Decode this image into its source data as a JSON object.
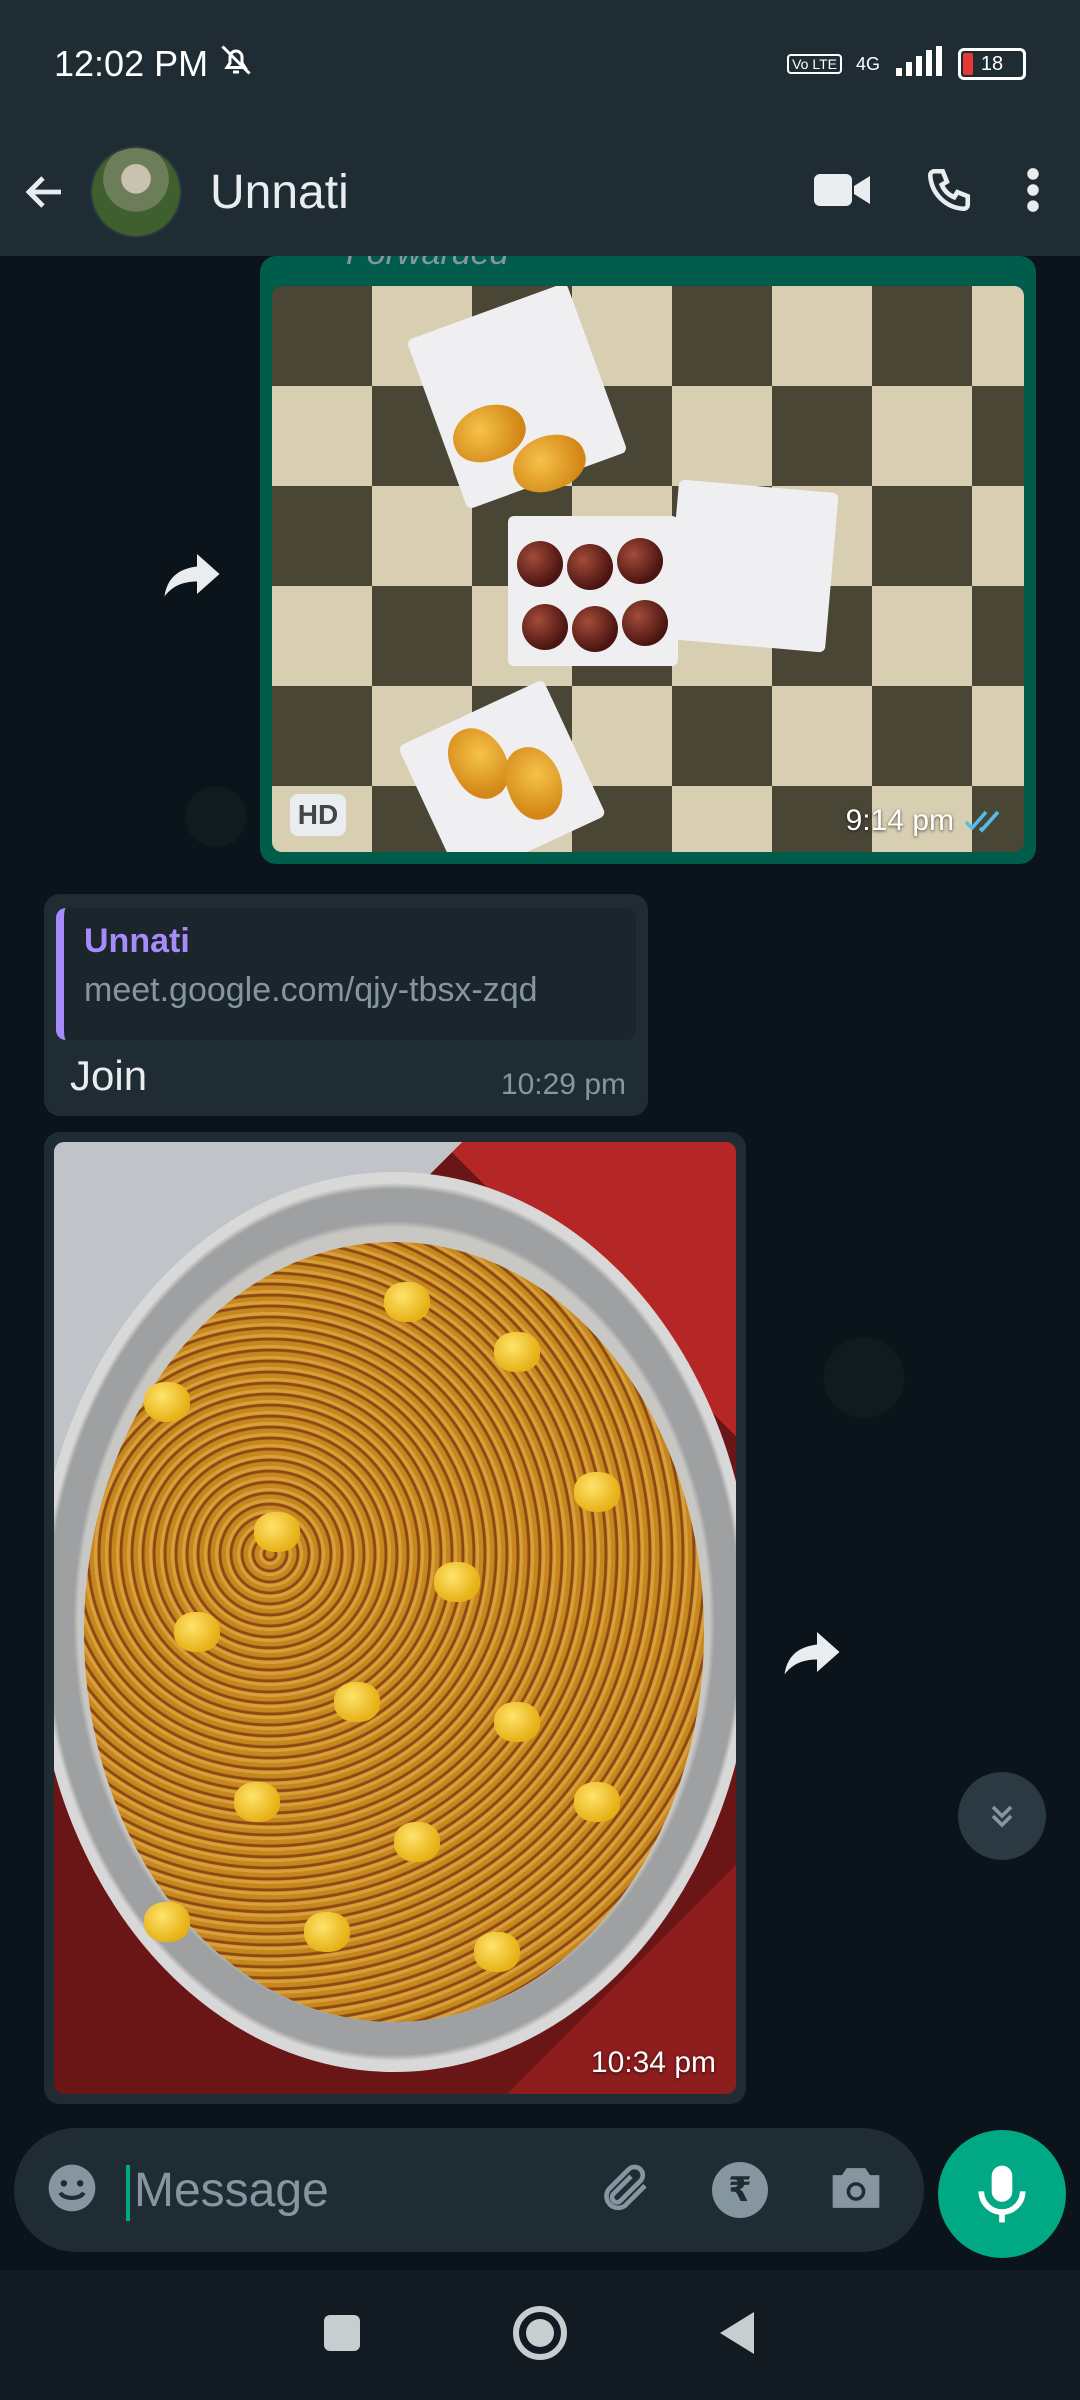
{
  "status_bar": {
    "time": "12:02 PM",
    "network": "4G",
    "volte": "Vo LTE",
    "battery": "18"
  },
  "header": {
    "contact_name": "Unnati",
    "icons": [
      "back-arrow-icon",
      "video-call-icon",
      "voice-call-icon",
      "more-options-icon"
    ]
  },
  "messages": [
    {
      "type": "image",
      "direction": "outgoing",
      "forwarded_label": "Forwarded",
      "badge": "HD",
      "time": "9:14 pm",
      "status": "read"
    },
    {
      "type": "text",
      "direction": "incoming",
      "quote_author": "Unnati",
      "quote_text": "meet.google.com/qjy-tbsx-zqd",
      "text": "Join",
      "time": "10:29 pm"
    },
    {
      "type": "image",
      "direction": "incoming",
      "time": "10:34 pm"
    }
  ],
  "composer": {
    "placeholder": "Message",
    "rupee_symbol": "₹"
  },
  "colors": {
    "accent": "#00a884",
    "outgoing_bubble": "#005c4b",
    "incoming_bubble": "#1f2c34",
    "chat_background": "#0b141a",
    "quote_author": "#a78bfa"
  }
}
